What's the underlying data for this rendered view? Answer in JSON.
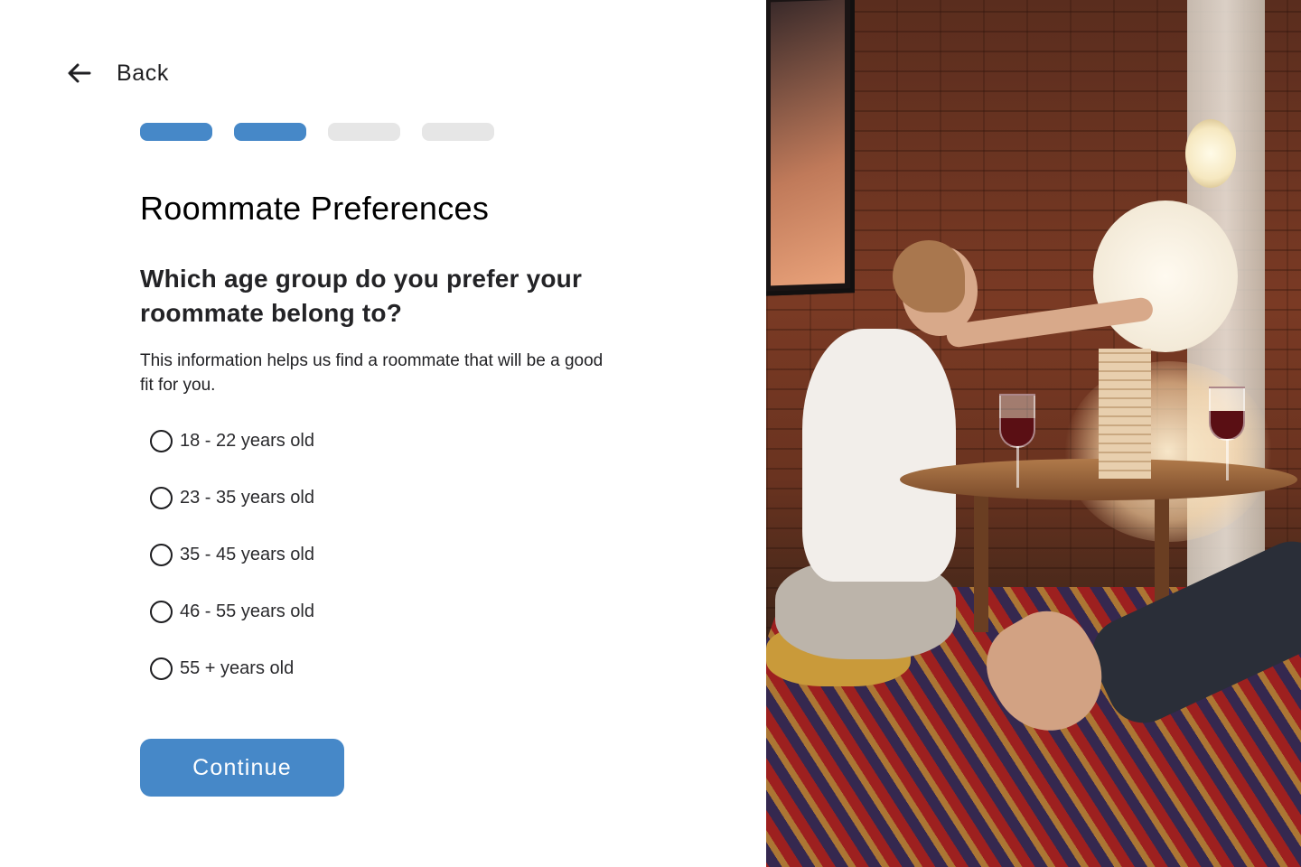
{
  "nav": {
    "back_label": "Back",
    "back_icon": "arrow-left-icon"
  },
  "progress": {
    "total_steps": 4,
    "completed_steps": 2,
    "active_color": "#4688c8",
    "inactive_color": "#e6e6e6"
  },
  "page": {
    "title": "Roommate Preferences",
    "question_line1": "Which age group do you prefer your",
    "question_line2": "roommate belong to?",
    "helper_line1": "This information helps us find a roommate that will be a good",
    "helper_line2": "fit for you."
  },
  "options": [
    {
      "label": "18 - 22 years old",
      "selected": false
    },
    {
      "label": "23 - 35 years old",
      "selected": false
    },
    {
      "label": "35 - 45 years old",
      "selected": false
    },
    {
      "label": "46 - 55 years old",
      "selected": false
    },
    {
      "label": "55 + years old",
      "selected": false
    }
  ],
  "actions": {
    "continue_label": "Continue",
    "accent_color": "#4688c8"
  }
}
